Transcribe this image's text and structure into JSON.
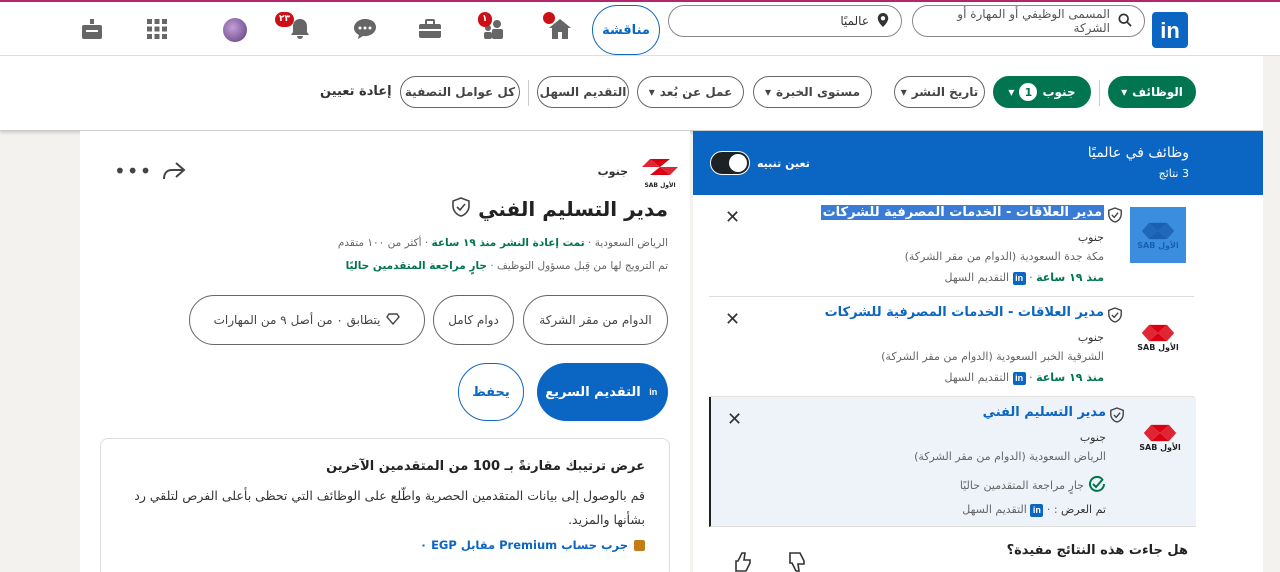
{
  "topbar": {
    "search_placeholder": "المسمى الوظيفي أو المهارة أو الشركة",
    "location_value": "عالميًا",
    "compete_label": "مناقشة",
    "home_badge": "",
    "network_badge": "١",
    "notifications_badge": "٢٣"
  },
  "filters": {
    "jobs_label": "الوظائف",
    "south_label": "جنوب",
    "south_count": "1",
    "date_posted": "تاريخ النشر",
    "experience": "مستوى الخبرة",
    "remote": "عمل عن بُعد",
    "easy_apply": "التقديم السهل",
    "all_filters": "كل عوامل التصفية",
    "reset": "إعادة تعيين"
  },
  "list": {
    "header_title": "وظائف في عالميًا",
    "header_count": "3 نتائج",
    "alert_label": "تعين تنبيه",
    "jobs": [
      {
        "title": "مدير العلاقات - الخدمات المصرفية للشركات",
        "company": "جنوب",
        "location": "مكة جدة السعودية (الدوام من مقر الشركة)",
        "posted": "منذ ١٩ ساعة",
        "easy_apply": "التقديم السهل",
        "logo_text": "الأول SAB"
      },
      {
        "title": "مدير العلاقات - الخدمات المصرفية للشركات",
        "company": "جنوب",
        "location": "الشرقية الخبر السعودية (الدوام من مقر الشركة)",
        "posted": "منذ ١٩ ساعة",
        "easy_apply": "التقديم السهل",
        "logo_text": "الأول SAB"
      },
      {
        "title": "مدير التسليم الفني",
        "company": "جنوب",
        "location": "الرياض السعودية (الدوام من مقر الشركة)",
        "reviewing": "جارٍ مراجعة المتقدمين حاليًا",
        "posted": "تم العرض",
        "easy_apply": "التقديم السهل",
        "logo_text": "الأول SAB"
      }
    ],
    "feedback_question": "هل جاءت هذه النتائج مفيدة؟"
  },
  "detail": {
    "company": "جنوب",
    "logo_text": "الأول SAB",
    "title": "مدير التسليم الفني",
    "location": "الرياض السعودية",
    "reposted": "تمت إعادة النشر منذ ١٩ ساعة",
    "applicants": "أكثر من ١٠٠ متقدم",
    "promoted": "تم الترويج لها من قِبل مسؤول التوظيف",
    "reviewing": "جارٍ مراجعة المتقدمين حاليًا",
    "chip_onsite": "الدوام من مقر الشركة",
    "chip_fulltime": "دوام كامل",
    "chip_skills": "يتطابق ٠ من أصل ٩ من المهارات",
    "apply_label": "التقديم السريع",
    "save_label": "يحفظ",
    "premium_title": "عرض ترتيبك مقارنةً بـ 100 من المتقدمين الآخرين",
    "premium_body": "قم بالوصول إلى بيانات المتقدمين الحصرية واطّلع على الوظائف التي تحظى بأعلى الفرص لتلقي رد بشأنها والمزيد.",
    "premium_cta": "جرب حساب Premium مقابل EGP ٠"
  },
  "colors": {
    "linkedin_blue": "#0a66c2",
    "green": "#01754f",
    "sab_red": "#db0011"
  }
}
